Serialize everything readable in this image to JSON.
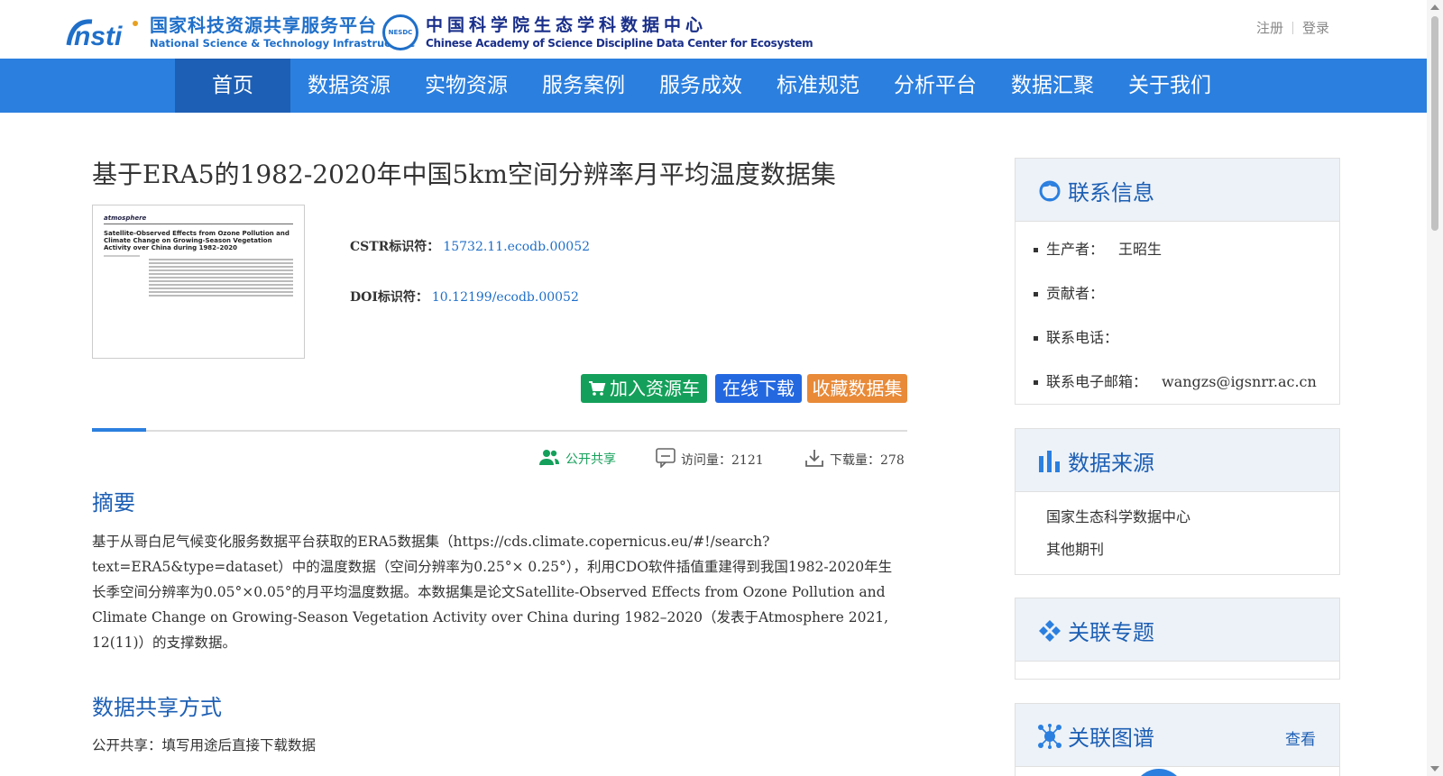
{
  "header": {
    "logo1_cn": "国家科技资源共享服务平台",
    "logo1_en": "National Science & Technology Infrastructure",
    "logo1_mark": "nsti",
    "logo2_cn": "中国科学院生态学科数据中心",
    "logo2_en": "Chinese Academy of Science Discipline Data Center for Ecosystem",
    "logo2_mark": "NESDC",
    "register": "注册",
    "login": "登录"
  },
  "nav": {
    "items": [
      {
        "label": "首页"
      },
      {
        "label": "数据资源"
      },
      {
        "label": "实物资源"
      },
      {
        "label": "服务案例"
      },
      {
        "label": "服务成效"
      },
      {
        "label": "标准规范"
      },
      {
        "label": "分析平台"
      },
      {
        "label": "数据汇聚"
      },
      {
        "label": "关于我们"
      }
    ]
  },
  "dataset": {
    "title": "基于ERA5的1982-2020年中国5km空间分辨率月平均温度数据集",
    "thumb_journal": "atmosphere",
    "thumb_title": "Satellite-Observed Effects from Ozone Pollution and Climate Change on Growing-Season Vegetation Activity over China during 1982–2020",
    "cstr_label": "CSTR标识符：",
    "cstr_value": "15732.11.ecodb.00052",
    "doi_label": "DOI标识符：",
    "doi_value": "10.12199/ecodb.00052"
  },
  "actions": {
    "cart": "加入资源车",
    "download": "在线下载",
    "favorite": "收藏数据集"
  },
  "stats": {
    "share": "公开共享",
    "visits": "访问量：2121",
    "downloads": "下载量：278"
  },
  "abstract": {
    "heading": "摘要",
    "text": "基于从哥白尼气候变化服务数据平台获取的ERA5数据集（https://cds.climate.copernicus.eu/#!/search?text=ERA5&type=dataset）中的温度数据（空间分辨率为0.25°× 0.25°），利用CDO软件插值重建得到我国1982-2020年生长季空间分辨率为0.05°×0.05°的月平均温度数据。本数据集是论文Satellite-Observed Effects from Ozone Pollution and Climate Change on Growing-Season Vegetation Activity over China during 1982–2020（发表于Atmosphere 2021, 12(11)）的支撑数据。"
  },
  "sharing": {
    "heading": "数据共享方式",
    "text": "公开共享：填写用途后直接下载数据"
  },
  "sidebar": {
    "contact": {
      "title": "联系信息",
      "producer_label": "生产者：",
      "producer_value": "王昭生",
      "contributor_label": "贡献者：",
      "phone_label": "联系电话：",
      "email_label": "联系电子邮箱：",
      "email_value": "wangzs@igsnrr.ac.cn"
    },
    "source": {
      "title": "数据来源",
      "items": [
        "国家生态科学数据中心",
        "其他期刊"
      ]
    },
    "topic": {
      "title": "关联专题"
    },
    "graph": {
      "title": "关联图谱",
      "more": "查看"
    }
  },
  "colors": {
    "nav_bg": "#2b7fdf",
    "nav_active": "#1d5fb4",
    "cart_btn": "#14a05a",
    "download_btn": "#2468e0",
    "favorite_btn": "#e88a38"
  }
}
